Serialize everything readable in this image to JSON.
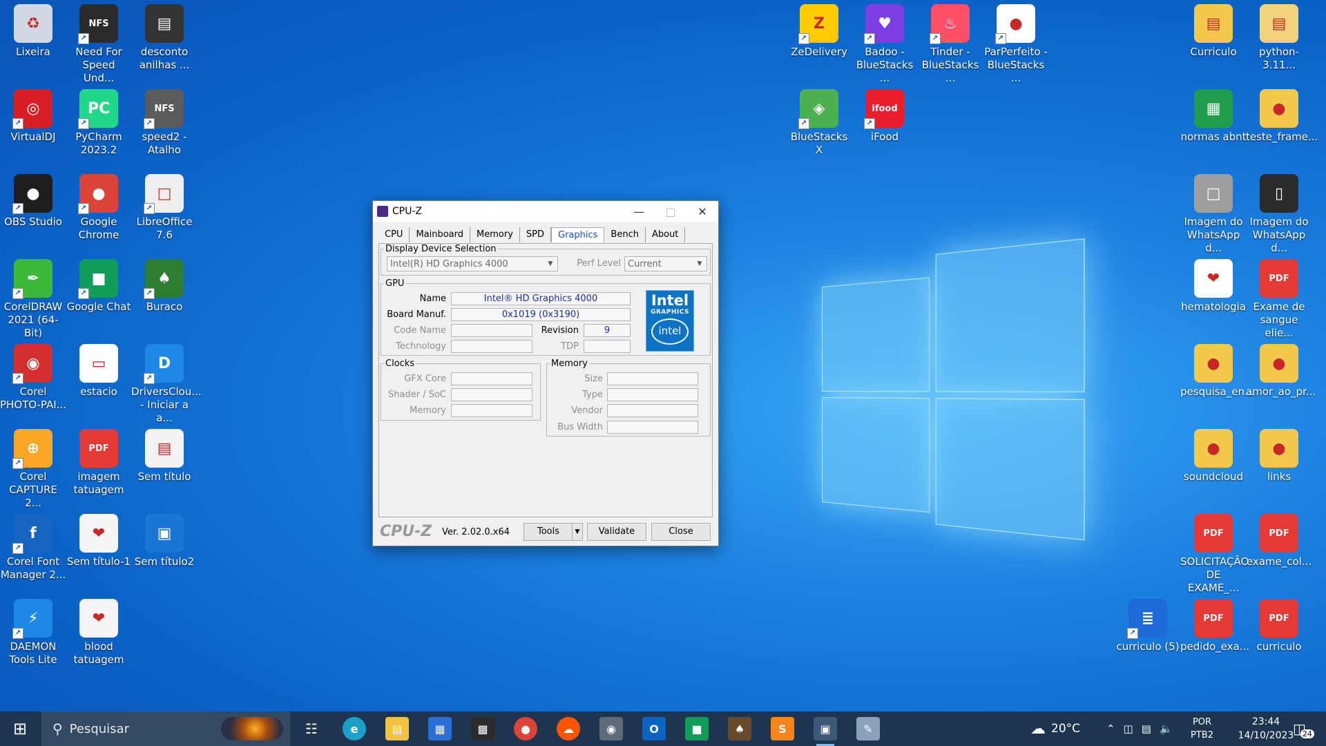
{
  "desktop": {
    "icons": [
      {
        "label": "Lixeira",
        "color": "#cfd8e3",
        "glyph": "♻"
      },
      {
        "label": "Need For Speed Und...",
        "color": "#2b2b2b",
        "glyph": "NFS"
      },
      {
        "label": "desconto anilhas ...",
        "color": "#333333",
        "glyph": "▤"
      },
      {
        "label": "VirtualDJ",
        "color": "#d81e24",
        "glyph": "◎"
      },
      {
        "label": "PyCharm 2023.2",
        "color": "#21d789",
        "glyph": "PC"
      },
      {
        "label": "speed2 - Atalho",
        "color": "#5b5b5b",
        "glyph": "NFS"
      },
      {
        "label": "OBS Studio",
        "color": "#1e1e1e",
        "glyph": "●"
      },
      {
        "label": "Google Chrome",
        "color": "#db4437",
        "glyph": "●"
      },
      {
        "label": "LibreOffice 7.6",
        "color": "#eeeeee",
        "glyph": "□"
      },
      {
        "label": "CorelDRAW 2021 (64-Bit)",
        "color": "#3db839",
        "glyph": "✒"
      },
      {
        "label": "Google Chat",
        "color": "#0f9d58",
        "glyph": "■"
      },
      {
        "label": "Buraco",
        "color": "#2e7d32",
        "glyph": "♠"
      },
      {
        "label": "Corel PHOTO-PAI...",
        "color": "#d32f2f",
        "glyph": "◉"
      },
      {
        "label": "estacio",
        "color": "#ffffff",
        "glyph": "▭"
      },
      {
        "label": "DriversClou... - Iniciar a a...",
        "color": "#1e88e5",
        "glyph": "D"
      },
      {
        "label": "Corel CAPTURE 2...",
        "color": "#f9a825",
        "glyph": "⊕"
      },
      {
        "label": "imagem tatuagem",
        "color": "#e53935",
        "glyph": "PDF"
      },
      {
        "label": "Sem título",
        "color": "#f2f2f2",
        "glyph": "▤"
      },
      {
        "label": "Corel Font Manager 2...",
        "color": "#1565c0",
        "glyph": "f"
      },
      {
        "label": "Sem título-1",
        "color": "#f5f5f5",
        "glyph": "❤"
      },
      {
        "label": "Sem título2",
        "color": "#1976d2",
        "glyph": "▣"
      },
      {
        "label": "DAEMON Tools Lite",
        "color": "#1e88e5",
        "glyph": "⚡"
      },
      {
        "label": "blood tatuagem",
        "color": "#f5f5f5",
        "glyph": "❤"
      },
      {
        "label": "ZeDelivery",
        "color": "#ffcc00",
        "glyph": "Z"
      },
      {
        "label": "Badoo - BlueStacks ...",
        "color": "#7b3fe4",
        "glyph": "♥"
      },
      {
        "label": "Tinder - BlueStacks ...",
        "color": "#fd5068",
        "glyph": "♨"
      },
      {
        "label": "ParPerfeito - BlueStacks ...",
        "color": "#ffffff",
        "glyph": "●"
      },
      {
        "label": "BlueStacks X",
        "color": "#4caf50",
        "glyph": "◈"
      },
      {
        "label": "iFood",
        "color": "#ea1d2c",
        "glyph": "ifood"
      },
      {
        "label": "Curriculo",
        "color": "#f2c94c",
        "glyph": "▤"
      },
      {
        "label": "python-3.11...",
        "color": "#f2d27a",
        "glyph": "▤"
      },
      {
        "label": "normas abnt",
        "color": "#1e9e4a",
        "glyph": "▦"
      },
      {
        "label": "teste_frame...",
        "color": "#f2c94c",
        "glyph": "●"
      },
      {
        "label": "Imagem do WhatsApp d...",
        "color": "#9e9e9e",
        "glyph": "□"
      },
      {
        "label": "Imagem do WhatsApp d...",
        "color": "#2b2b2b",
        "glyph": "▯"
      },
      {
        "label": "hematologia",
        "color": "#ffffff",
        "glyph": "❤"
      },
      {
        "label": "Exame de sangue elie...",
        "color": "#e53935",
        "glyph": "PDF"
      },
      {
        "label": "pesquisa_en...",
        "color": "#f2c94c",
        "glyph": "●"
      },
      {
        "label": "amor_ao_pr...",
        "color": "#f2c94c",
        "glyph": "●"
      },
      {
        "label": "soundcloud",
        "color": "#f2c94c",
        "glyph": "●"
      },
      {
        "label": "links",
        "color": "#f2c94c",
        "glyph": "●"
      },
      {
        "label": "SOLICITAÇÃO DE EXAME_...",
        "color": "#e53935",
        "glyph": "PDF"
      },
      {
        "label": "exame_col...",
        "color": "#e53935",
        "glyph": "PDF"
      },
      {
        "label": "curriculo (5)",
        "color": "#1e6ad6",
        "glyph": "≣"
      },
      {
        "label": "pedido_exa...",
        "color": "#e53935",
        "glyph": "PDF"
      },
      {
        "label": "curriculo",
        "color": "#e53935",
        "glyph": "PDF"
      }
    ]
  },
  "cpuz": {
    "title": "CPU-Z",
    "tabs": [
      "CPU",
      "Mainboard",
      "Memory",
      "SPD",
      "Graphics",
      "Bench",
      "About"
    ],
    "active_tab": "Graphics",
    "display_selection": {
      "legend": "Display Device Selection",
      "device": "Intel(R) HD Graphics 4000",
      "perf_label": "Perf Level",
      "perf_value": "Current"
    },
    "gpu": {
      "legend": "GPU",
      "name_label": "Name",
      "name_value": "Intel® HD Graphics 4000",
      "board_label": "Board Manuf.",
      "board_value": "0x1019 (0x3190)",
      "code_label": "Code Name",
      "code_value": "",
      "revision_label": "Revision",
      "revision_value": "9",
      "tech_label": "Technology",
      "tech_value": "",
      "tdp_label": "TDP",
      "tdp_value": "",
      "logo_line1": "Intel",
      "logo_line2": "GRAPHICS",
      "logo_line3": "intel"
    },
    "clocks": {
      "legend": "Clocks",
      "gfx_label": "GFX Core",
      "shader_label": "Shader / SoC",
      "memory_label": "Memory"
    },
    "memory": {
      "legend": "Memory",
      "size_label": "Size",
      "type_label": "Type",
      "vendor_label": "Vendor",
      "bus_label": "Bus Width"
    },
    "footer": {
      "logo": "CPU-Z",
      "version": "Ver. 2.02.0.x64",
      "tools": "Tools",
      "validate": "Validate",
      "close": "Close"
    }
  },
  "taskbar": {
    "search_placeholder": "Pesquisar",
    "weather": "20°C",
    "lang_line1": "POR",
    "lang_line2": "PTB2",
    "time": "23:44",
    "date": "14/10/2023",
    "notifications": "24"
  }
}
